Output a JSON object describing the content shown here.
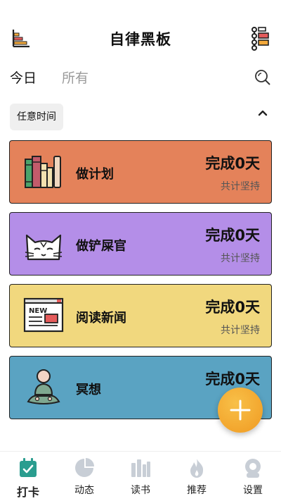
{
  "header": {
    "title": "自律黑板"
  },
  "tabs": [
    {
      "label": "今日"
    },
    {
      "label": "所有"
    }
  ],
  "filter": {
    "label": "任意时间"
  },
  "cards": [
    {
      "name": "做计划",
      "status": "完成0天",
      "sub": "共计坚持",
      "color": "#e4825a",
      "icon": "books-icon"
    },
    {
      "name": "做铲屎官",
      "status": "完成0天",
      "sub": "共计坚持",
      "color": "#b48ee8",
      "icon": "cat-icon"
    },
    {
      "name": "阅读新闻",
      "status": "完成0天",
      "sub": "共计坚持",
      "color": "#f1d87e",
      "icon": "newspaper-icon"
    },
    {
      "name": "冥想",
      "status": "完成0天",
      "sub": "",
      "color": "#5aa3c2",
      "icon": "meditation-icon"
    }
  ],
  "nav": [
    {
      "label": "打卡",
      "icon": "checkin-icon",
      "active": true
    },
    {
      "label": "动态",
      "icon": "pie-chart-icon"
    },
    {
      "label": "读书",
      "icon": "books-nav-icon"
    },
    {
      "label": "推荐",
      "icon": "flame-icon"
    },
    {
      "label": "设置",
      "icon": "settings-icon"
    }
  ],
  "colors": {
    "accent": "#f3a93b",
    "fab": "#f09a22",
    "nav_active": "#2a9d8f",
    "nav_inactive": "#c8ced6"
  }
}
